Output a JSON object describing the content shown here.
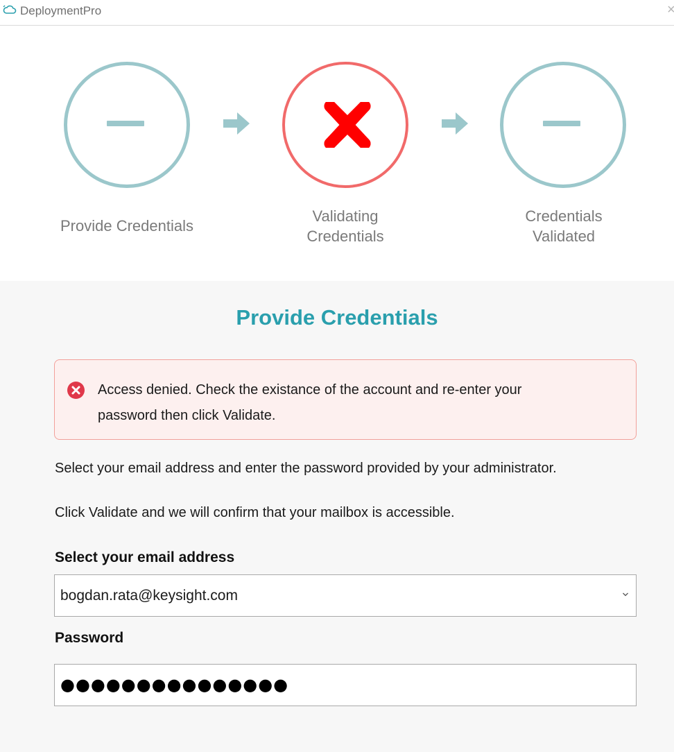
{
  "app": {
    "title": "DeploymentPro",
    "close_glyph": "×",
    "logo_icon": "cloud-icon"
  },
  "steps": [
    {
      "label": "Provide Credentials",
      "status": "pending",
      "icon": "minus-icon"
    },
    {
      "label": "Validating Credentials",
      "status": "error",
      "icon": "x-icon"
    },
    {
      "label": "Credentials Validated",
      "status": "pending",
      "icon": "minus-icon"
    }
  ],
  "step_labels": {
    "provide": "Provide Credentials",
    "validating_1": "Validating",
    "validating_2": "Credentials",
    "validated_1": "Credentials",
    "validated_2": "Validated"
  },
  "form": {
    "heading": "Provide Credentials",
    "alert": {
      "line1": "Access denied. Check the existance of the account and re-enter your",
      "line2": "password then click Validate.",
      "icon": "error-circle-icon"
    },
    "instruction1": "Select your email address and enter the password provided by your administrator.",
    "instruction2": "Click Validate and we will confirm that your mailbox is accessible.",
    "email_label": "Select your email address",
    "email_value": "bogdan.rata@keysight.com",
    "password_label": "Password",
    "password_value": "●●●●●●●●●●●●●●●"
  },
  "colors": {
    "accent": "#2a9fad",
    "step_pending": "#9bc7cb",
    "step_error": "#f16a6a",
    "error_icon": "#ff0000",
    "alert_bg": "#fdf0ef",
    "alert_border": "#f2a09a",
    "alert_icon": "#e0384a"
  }
}
